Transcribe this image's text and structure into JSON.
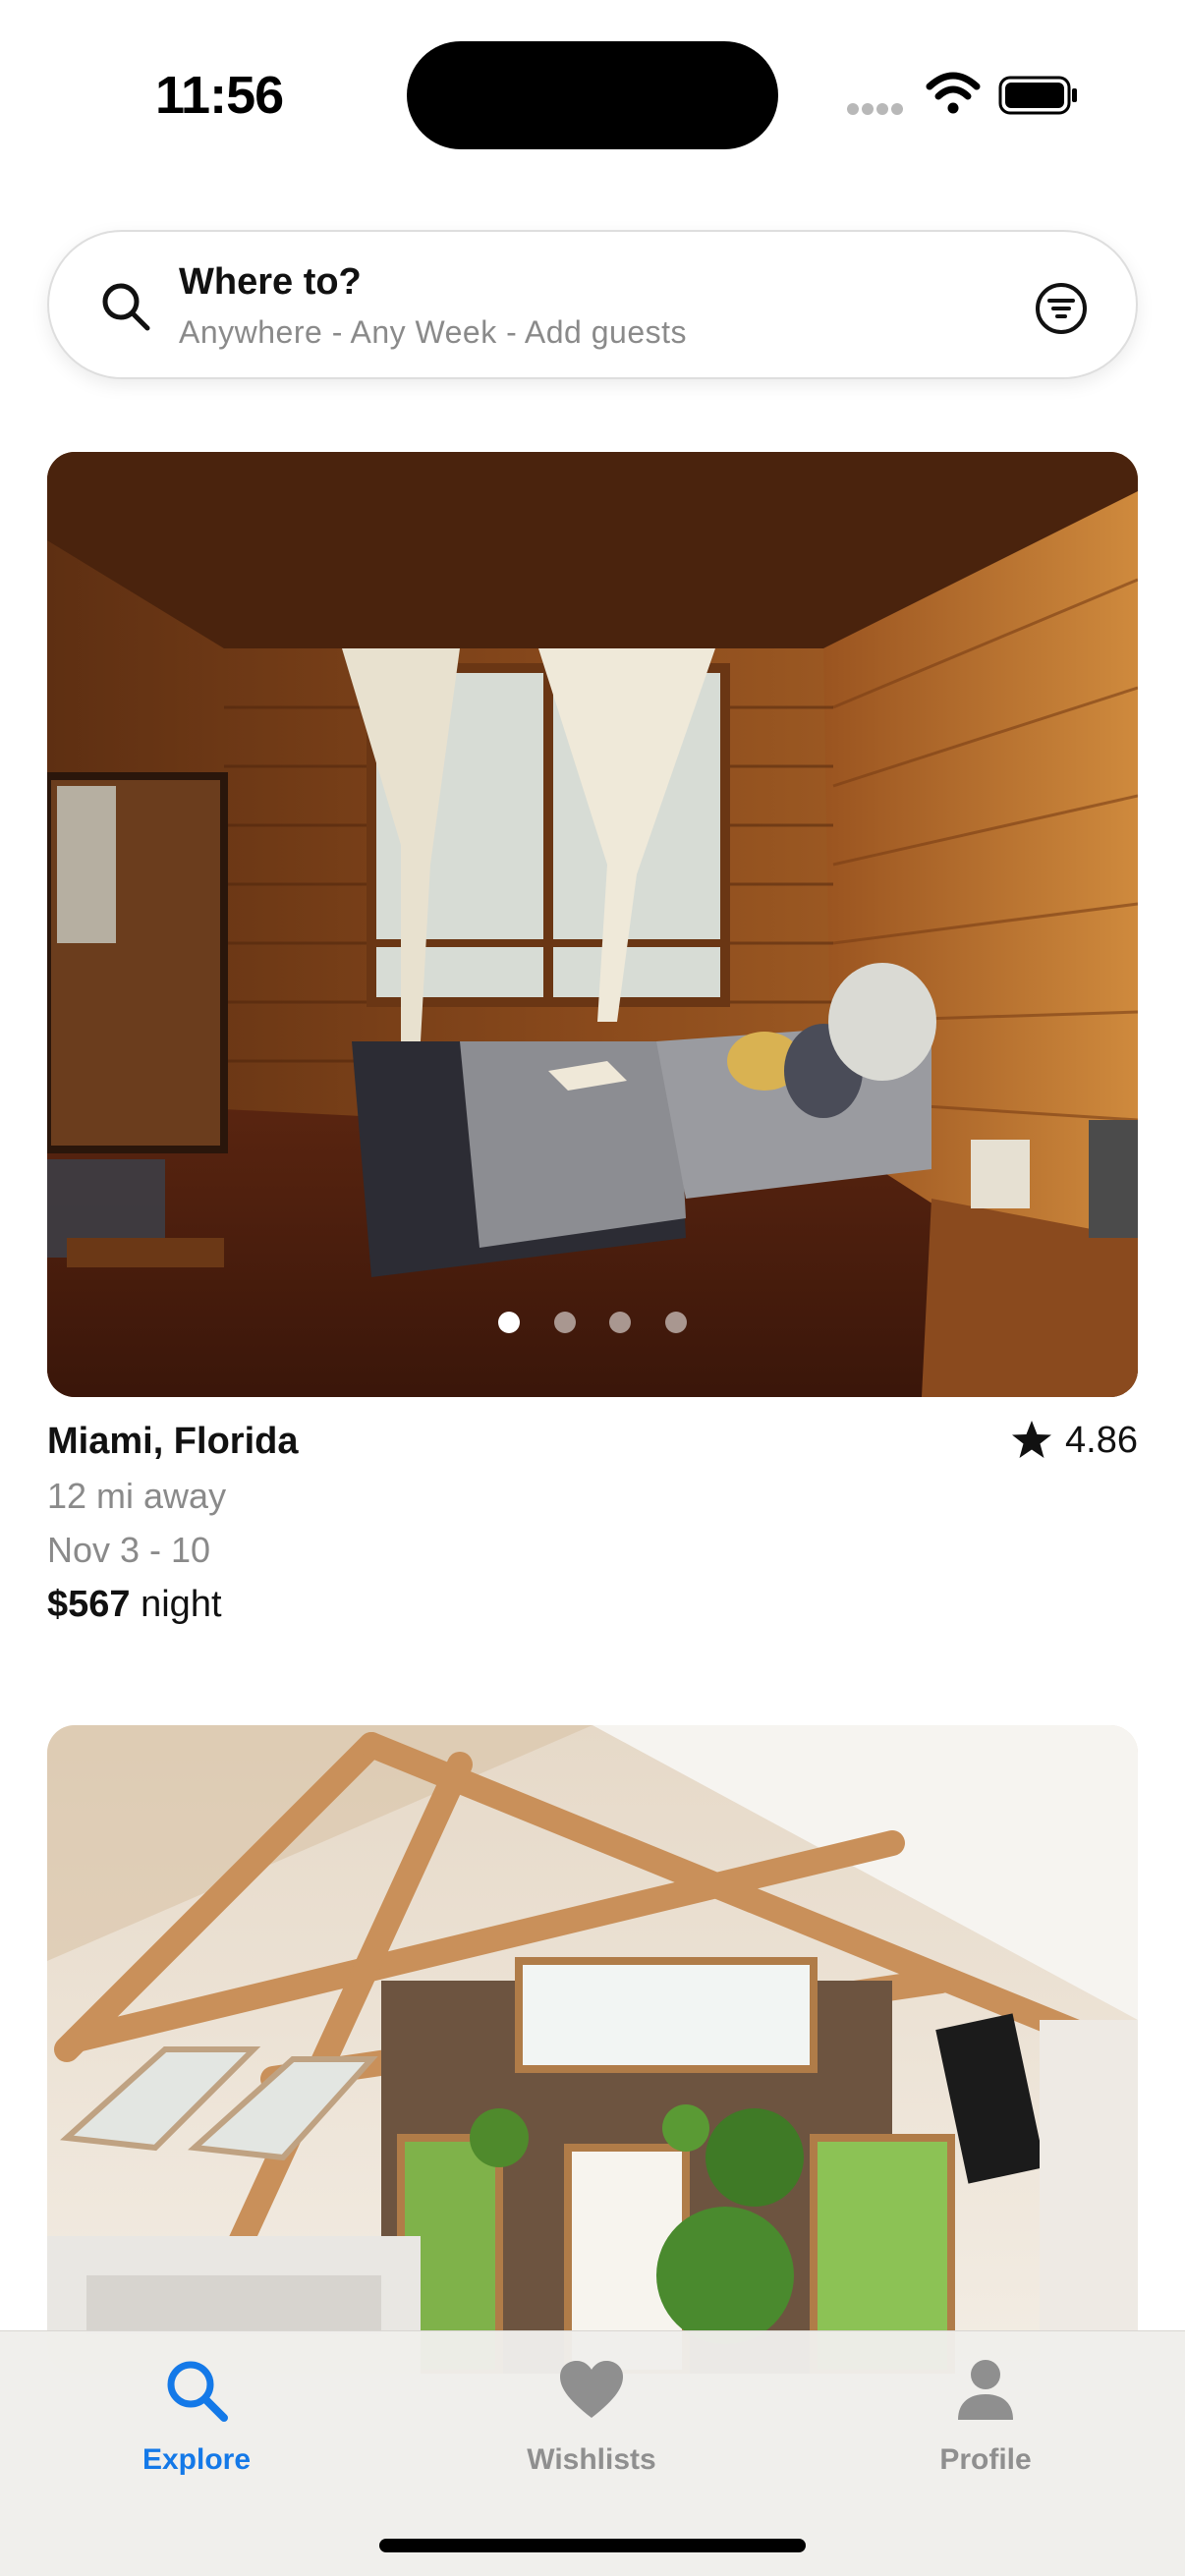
{
  "status": {
    "time": "11:56"
  },
  "search": {
    "title": "Where to?",
    "subtitle": "Anywhere - Any Week - Add guests"
  },
  "listings": [
    {
      "location": "Miami, Florida",
      "rating": "4.86",
      "distance": "12 mi away",
      "dates": "Nov 3 - 10",
      "price": "$567",
      "price_unit": "night",
      "photo_count": 4,
      "active_photo": 1
    }
  ],
  "tabs": [
    {
      "label": "Explore",
      "icon": "search-icon",
      "active": true
    },
    {
      "label": "Wishlists",
      "icon": "heart-icon",
      "active": false
    },
    {
      "label": "Profile",
      "icon": "person-icon",
      "active": false
    }
  ],
  "colors": {
    "accent": "#1479e8",
    "inactive": "#8f8f8f",
    "secondary_text": "#8a8a8a"
  }
}
